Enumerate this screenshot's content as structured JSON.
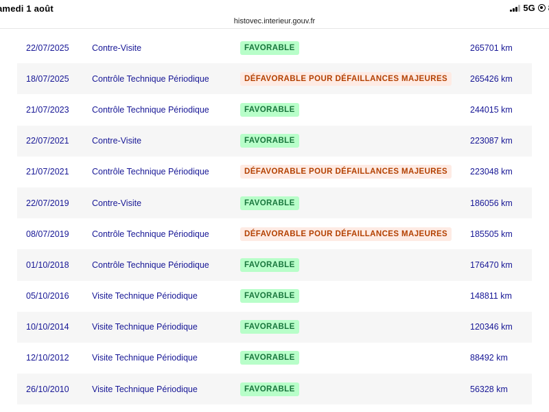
{
  "status_bar": {
    "time_date": "amedi 1 août",
    "network": "5G",
    "battery": "8"
  },
  "browser": {
    "url": "histovec.interieur.gouv.fr"
  },
  "colors": {
    "favorable_bg": "#b8fec9",
    "favorable_text": "#18753c",
    "defavorable_bg": "#feebe4",
    "defavorable_text": "#b34000",
    "row_text": "#161695"
  },
  "controls": {
    "rows": [
      {
        "date": "22/07/2025",
        "type": "Contre-Visite",
        "result": "FAVORABLE",
        "status": "favorable",
        "km": "265701 km"
      },
      {
        "date": "18/07/2025",
        "type": "Contrôle Technique Périodique",
        "result": "DÉFAVORABLE POUR DÉFAILLANCES MAJEURES",
        "status": "defavorable",
        "km": "265426 km"
      },
      {
        "date": "21/07/2023",
        "type": "Contrôle Technique Périodique",
        "result": "FAVORABLE",
        "status": "favorable",
        "km": "244015 km"
      },
      {
        "date": "22/07/2021",
        "type": "Contre-Visite",
        "result": "FAVORABLE",
        "status": "favorable",
        "km": "223087 km"
      },
      {
        "date": "21/07/2021",
        "type": "Contrôle Technique Périodique",
        "result": "DÉFAVORABLE POUR DÉFAILLANCES MAJEURES",
        "status": "defavorable",
        "km": "223048 km"
      },
      {
        "date": "22/07/2019",
        "type": "Contre-Visite",
        "result": "FAVORABLE",
        "status": "favorable",
        "km": "186056 km"
      },
      {
        "date": "08/07/2019",
        "type": "Contrôle Technique Périodique",
        "result": "DÉFAVORABLE POUR DÉFAILLANCES MAJEURES",
        "status": "defavorable",
        "km": "185505 km"
      },
      {
        "date": "01/10/2018",
        "type": "Contrôle Technique Périodique",
        "result": "FAVORABLE",
        "status": "favorable",
        "km": "176470 km"
      },
      {
        "date": "05/10/2016",
        "type": "Visite Technique Périodique",
        "result": "FAVORABLE",
        "status": "favorable",
        "km": "148811 km"
      },
      {
        "date": "10/10/2014",
        "type": "Visite Technique Périodique",
        "result": "FAVORABLE",
        "status": "favorable",
        "km": "120346 km"
      },
      {
        "date": "12/10/2012",
        "type": "Visite Technique Périodique",
        "result": "FAVORABLE",
        "status": "favorable",
        "km": "88492 km"
      },
      {
        "date": "26/10/2010",
        "type": "Visite Technique Périodique",
        "result": "FAVORABLE",
        "status": "favorable",
        "km": "56328 km"
      }
    ]
  }
}
